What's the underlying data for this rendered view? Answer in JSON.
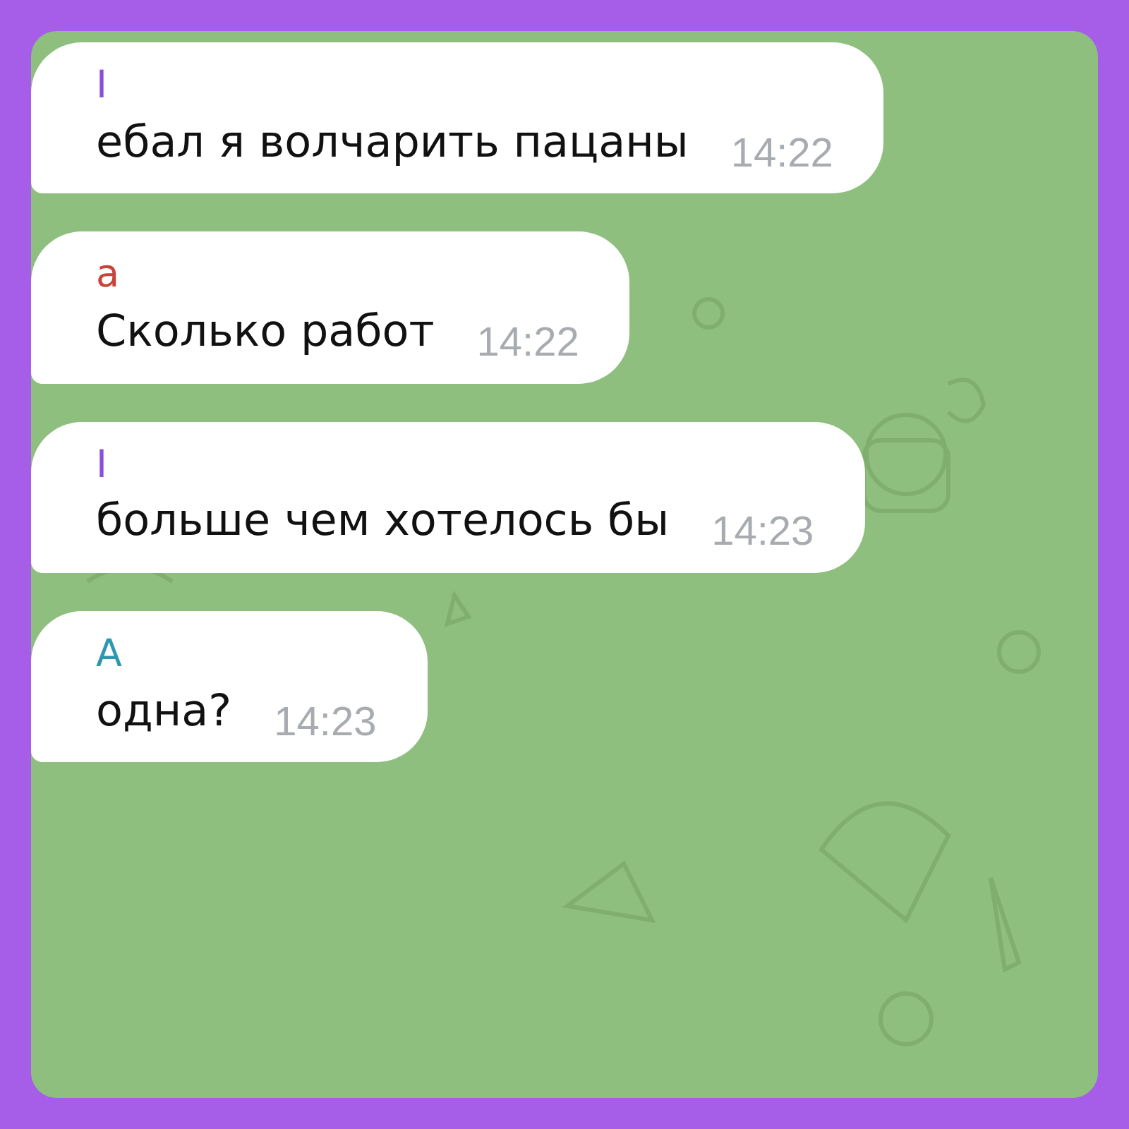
{
  "messages": [
    {
      "sender": "I",
      "color": "#8a4fd6",
      "text": "ебал я волчарить пацаны",
      "time": "14:22"
    },
    {
      "sender": "а",
      "color": "#c8433a",
      "text": "Сколько работ",
      "time": "14:22"
    },
    {
      "sender": "I",
      "color": "#8a4fd6",
      "text": "больше чем хотелось бы",
      "time": "14:23"
    },
    {
      "sender": "А",
      "color": "#2e97b0",
      "text": "одна?",
      "time": "14:23"
    }
  ]
}
